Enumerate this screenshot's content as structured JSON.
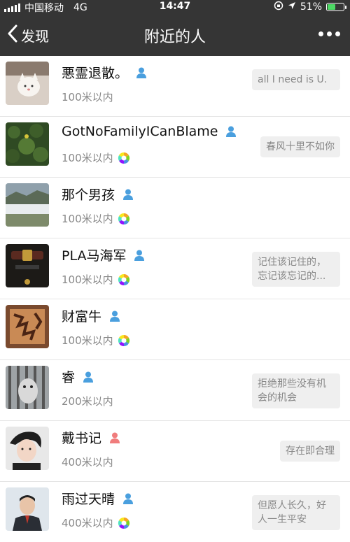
{
  "status_bar": {
    "carrier": "中国移动",
    "network": "4G",
    "time": "14:47",
    "battery_percent": "51%",
    "battery_level": 0.51
  },
  "nav": {
    "back_label": "发现",
    "title": "附近的人"
  },
  "colors": {
    "bar_bg": "#353535",
    "male_icon": "#4a9fde",
    "female_icon": "#f07c7c"
  },
  "people": [
    {
      "name": "悪霊退散。",
      "distance": "100米以内",
      "gender": "male",
      "moments": false,
      "signature": "all I need is U."
    },
    {
      "name": "GotNoFamilyICanBlame",
      "distance": "100米以内",
      "gender": "male",
      "moments": true,
      "signature": "春风十里不如你"
    },
    {
      "name": "那个男孩",
      "distance": "100米以内",
      "gender": "male",
      "moments": true,
      "signature": ""
    },
    {
      "name": "PLA马海军",
      "distance": "100米以内",
      "gender": "male",
      "moments": true,
      "signature": "记住该记住的，忘记该忘记的..."
    },
    {
      "name": "财富牛",
      "distance": "100米以内",
      "gender": "male",
      "moments": true,
      "signature": ""
    },
    {
      "name": "睿",
      "distance": "200米以内",
      "gender": "male",
      "moments": false,
      "signature": "拒绝那些没有机会的机会"
    },
    {
      "name": "戴书记",
      "distance": "400米以内",
      "gender": "female",
      "moments": false,
      "signature": "存在即合理"
    },
    {
      "name": "雨过天晴",
      "distance": "400米以内",
      "gender": "male",
      "moments": true,
      "signature": "但愿人长久，好人一生平安"
    }
  ]
}
